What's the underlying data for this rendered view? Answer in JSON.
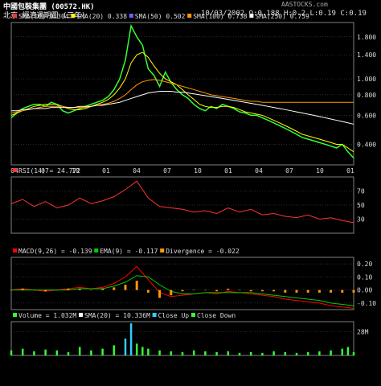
{
  "header": {
    "title": "中國包裝集團 (00572.HK)",
    "subtitle": "北京 經濟週期圖 (三年)",
    "ohlc": "10/03/2002 O:0.188 H:0.2 L:0.19 C:0.19",
    "source": "AASTOCKS.com"
  },
  "colors": {
    "bg": "#000000",
    "grid": "#555555",
    "frame": "#808080",
    "price": "#33ff33",
    "ma10": "#ff3333",
    "ma20": "#ffff00",
    "ma50": "#6666ff",
    "ma100": "#ff9900",
    "ma250": "#ffffff",
    "rsi": "#ff3333",
    "macd": "#ff0000",
    "ema": "#00cc00",
    "div": "#ff9900",
    "vol_up": "#33ccff",
    "vol_dn": "#33ff33",
    "sma_vol": "#ffffff"
  },
  "chart_data": [
    {
      "type": "line",
      "panel": "price",
      "legend": [
        {
          "label": "SMA(10) 0.304",
          "color": "#ff3333"
        },
        {
          "label": "SMA(20) 0.338",
          "color": "#ffff00"
        },
        {
          "label": "SMA(50) 0.502",
          "color": "#6666ff"
        },
        {
          "label": "SMA(100) 0.738",
          "color": "#ff9900"
        },
        {
          "label": "SMA(250) 0.759",
          "color": "#ffffff"
        }
      ],
      "x_ticks": [
        "04",
        "07",
        "10",
        "01",
        "04",
        "07",
        "10",
        "01",
        "04",
        "07",
        "10",
        "01"
      ],
      "y_ticks": [
        "1.800",
        "1.400",
        "1.000",
        "0.800",
        "0.600",
        "0.400"
      ],
      "y_tick_values": [
        1.8,
        1.4,
        1.0,
        0.8,
        0.6,
        0.4
      ],
      "log_scale": true,
      "ylim": [
        0.3,
        2.2
      ],
      "x": [
        0,
        2,
        4,
        6,
        8,
        10,
        12,
        14,
        16,
        18,
        20,
        22,
        24,
        26,
        28,
        30,
        32,
        34,
        36,
        38,
        40,
        42,
        44,
        46,
        48,
        50,
        52,
        54,
        56,
        58,
        60,
        62,
        64,
        66,
        68,
        70,
        72,
        74,
        76,
        78,
        80,
        82,
        84,
        86,
        88,
        90,
        92,
        94,
        96,
        98,
        100,
        102,
        104,
        106,
        108,
        110,
        112,
        114,
        116,
        118,
        120
      ],
      "series": [
        {
          "name": "price",
          "values": [
            0.58,
            0.62,
            0.66,
            0.68,
            0.7,
            0.7,
            0.68,
            0.72,
            0.7,
            0.64,
            0.62,
            0.64,
            0.66,
            0.68,
            0.7,
            0.72,
            0.74,
            0.78,
            0.86,
            1.0,
            1.3,
            2.1,
            1.8,
            1.6,
            1.15,
            1.05,
            0.9,
            1.1,
            0.95,
            0.86,
            0.8,
            0.76,
            0.7,
            0.66,
            0.64,
            0.68,
            0.66,
            0.7,
            0.68,
            0.66,
            0.63,
            0.62,
            0.6,
            0.6,
            0.58,
            0.56,
            0.54,
            0.52,
            0.5,
            0.48,
            0.46,
            0.44,
            0.43,
            0.42,
            0.41,
            0.4,
            0.39,
            0.38,
            0.4,
            0.36,
            0.33
          ]
        },
        {
          "name": "SMA(20)",
          "values": [
            0.6,
            0.62,
            0.64,
            0.66,
            0.68,
            0.69,
            0.7,
            0.7,
            0.7,
            0.68,
            0.66,
            0.65,
            0.65,
            0.66,
            0.68,
            0.7,
            0.72,
            0.75,
            0.8,
            0.88,
            1.0,
            1.25,
            1.4,
            1.45,
            1.35,
            1.2,
            1.08,
            1.0,
            0.96,
            0.92,
            0.86,
            0.8,
            0.75,
            0.7,
            0.68,
            0.67,
            0.67,
            0.68,
            0.68,
            0.67,
            0.65,
            0.63,
            0.62,
            0.61,
            0.6,
            0.58,
            0.56,
            0.54,
            0.52,
            0.5,
            0.48,
            0.46,
            0.45,
            0.44,
            0.43,
            0.42,
            0.41,
            0.4,
            0.4,
            0.38,
            0.36
          ]
        },
        {
          "name": "SMA(100)",
          "values": [
            0.62,
            0.63,
            0.64,
            0.65,
            0.66,
            0.67,
            0.68,
            0.68,
            0.68,
            0.68,
            0.67,
            0.67,
            0.67,
            0.67,
            0.68,
            0.69,
            0.7,
            0.71,
            0.73,
            0.76,
            0.8,
            0.86,
            0.92,
            0.96,
            0.98,
            0.99,
            0.98,
            0.96,
            0.94,
            0.92,
            0.9,
            0.88,
            0.86,
            0.84,
            0.82,
            0.8,
            0.79,
            0.78,
            0.77,
            0.76,
            0.75,
            0.74,
            0.73,
            0.73,
            0.72,
            0.72,
            0.72,
            0.72,
            0.72,
            0.72,
            0.72,
            0.72,
            0.72,
            0.72,
            0.72,
            0.72,
            0.72,
            0.72,
            0.72,
            0.72,
            0.72
          ]
        },
        {
          "name": "SMA(250)",
          "values": [
            0.64,
            0.64,
            0.65,
            0.65,
            0.66,
            0.66,
            0.66,
            0.67,
            0.67,
            0.67,
            0.67,
            0.67,
            0.68,
            0.68,
            0.68,
            0.69,
            0.69,
            0.7,
            0.71,
            0.72,
            0.74,
            0.76,
            0.78,
            0.8,
            0.82,
            0.83,
            0.84,
            0.84,
            0.84,
            0.83,
            0.83,
            0.82,
            0.81,
            0.8,
            0.79,
            0.78,
            0.77,
            0.76,
            0.75,
            0.74,
            0.73,
            0.72,
            0.71,
            0.7,
            0.69,
            0.68,
            0.67,
            0.66,
            0.65,
            0.64,
            0.63,
            0.62,
            0.61,
            0.6,
            0.59,
            0.58,
            0.57,
            0.56,
            0.55,
            0.54,
            0.53
          ]
        }
      ]
    },
    {
      "type": "line",
      "panel": "rsi",
      "legend": [
        {
          "label": "RSI(14) = 24.772",
          "color": "#ff3333"
        }
      ],
      "y_ticks": [
        "70",
        "50",
        "30"
      ],
      "y_tick_values": [
        70,
        50,
        30
      ],
      "ylim": [
        10,
        90
      ],
      "x": [
        0,
        4,
        8,
        12,
        16,
        20,
        24,
        28,
        32,
        36,
        40,
        44,
        48,
        52,
        56,
        60,
        64,
        68,
        72,
        76,
        80,
        84,
        88,
        92,
        96,
        100,
        104,
        108,
        112,
        116,
        120
      ],
      "series": [
        {
          "name": "RSI(14)",
          "values": [
            52,
            58,
            48,
            55,
            46,
            50,
            60,
            52,
            56,
            62,
            72,
            84,
            60,
            48,
            46,
            44,
            40,
            42,
            38,
            46,
            40,
            44,
            36,
            38,
            34,
            32,
            36,
            30,
            32,
            28,
            25
          ]
        }
      ]
    },
    {
      "type": "line",
      "panel": "macd",
      "legend": [
        {
          "label": "MACD(9,26) = -0.139",
          "color": "#ff0000"
        },
        {
          "label": "EMA(9) = -0.117",
          "color": "#00cc00"
        },
        {
          "label": "Divergence = -0.022",
          "color": "#ff9900"
        }
      ],
      "y_ticks": [
        "0.20",
        "0.10",
        "0.00",
        "-0.10"
      ],
      "y_tick_values": [
        0.2,
        0.1,
        0.0,
        -0.1
      ],
      "ylim": [
        -0.15,
        0.25
      ],
      "x": [
        0,
        4,
        8,
        12,
        16,
        20,
        24,
        28,
        32,
        36,
        40,
        44,
        48,
        52,
        56,
        60,
        64,
        68,
        72,
        76,
        80,
        84,
        88,
        92,
        96,
        100,
        104,
        108,
        112,
        116,
        120
      ],
      "series": [
        {
          "name": "MACD",
          "values": [
            0.0,
            0.01,
            0.0,
            -0.01,
            0.0,
            0.01,
            0.02,
            0.01,
            0.02,
            0.05,
            0.1,
            0.18,
            0.08,
            -0.02,
            -0.05,
            -0.04,
            -0.03,
            -0.02,
            -0.03,
            -0.01,
            -0.02,
            -0.03,
            -0.04,
            -0.05,
            -0.07,
            -0.08,
            -0.09,
            -0.1,
            -0.12,
            -0.13,
            -0.14
          ]
        },
        {
          "name": "EMA(9)",
          "values": [
            0.0,
            0.0,
            0.0,
            0.0,
            0.0,
            0.0,
            0.01,
            0.01,
            0.01,
            0.03,
            0.06,
            0.11,
            0.1,
            0.04,
            -0.01,
            -0.03,
            -0.03,
            -0.02,
            -0.02,
            -0.02,
            -0.02,
            -0.02,
            -0.03,
            -0.04,
            -0.05,
            -0.06,
            -0.07,
            -0.08,
            -0.1,
            -0.11,
            -0.12
          ]
        }
      ]
    },
    {
      "type": "bar",
      "panel": "volume",
      "legend": [
        {
          "label": "Volume = 1.032M",
          "color": "#33ff33"
        },
        {
          "label": "SMA(20) = 10.336M",
          "color": "#ffffff"
        },
        {
          "label": "Close Up",
          "color": "#33ccff"
        },
        {
          "label": "Close Down",
          "color": "#33ff33"
        }
      ],
      "y_ticks": [
        "28M"
      ],
      "y_tick_values": [
        28
      ],
      "ylim": [
        0,
        40
      ],
      "x": [
        0,
        4,
        8,
        12,
        16,
        20,
        24,
        28,
        32,
        36,
        40,
        42,
        44,
        46,
        48,
        52,
        56,
        60,
        64,
        68,
        72,
        76,
        80,
        84,
        88,
        92,
        96,
        100,
        104,
        108,
        112,
        116,
        118,
        120
      ],
      "values": [
        6,
        8,
        5,
        7,
        6,
        4,
        10,
        6,
        8,
        12,
        20,
        38,
        14,
        10,
        8,
        6,
        5,
        4,
        6,
        5,
        4,
        5,
        3,
        4,
        3,
        5,
        4,
        3,
        4,
        5,
        6,
        8,
        10,
        4
      ]
    }
  ]
}
